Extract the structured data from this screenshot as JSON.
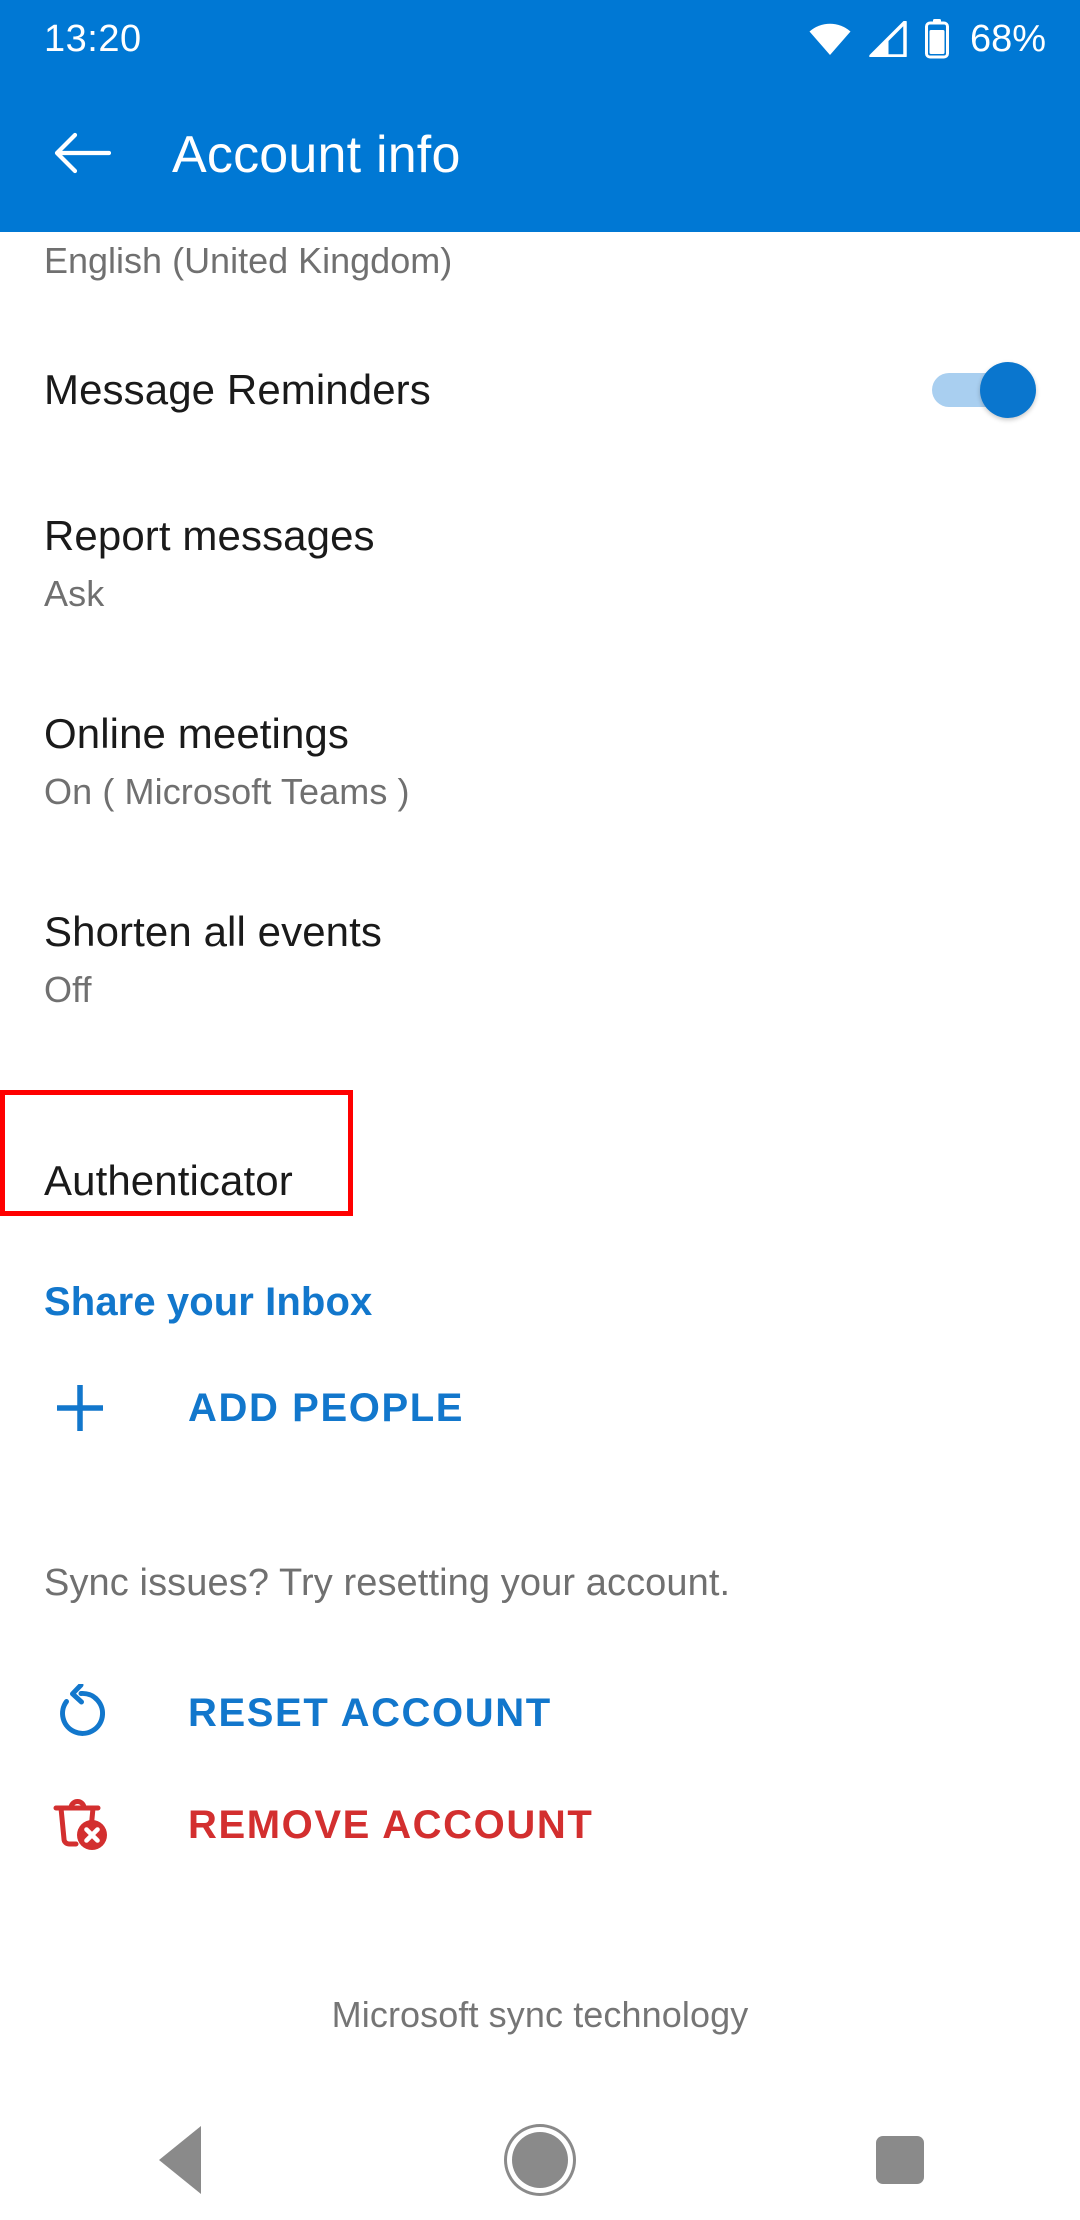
{
  "status_bar": {
    "time": "13:20",
    "battery_percent": "68%",
    "wifi_icon": "wifi-icon",
    "signal_icon": "cellular-signal-icon",
    "battery_icon": "battery-icon"
  },
  "app_bar": {
    "back_icon": "back-arrow-icon",
    "title": "Account info"
  },
  "content": {
    "cut_off_row_subtitle": "English (United Kingdom)",
    "rows": [
      {
        "title": "Message Reminders",
        "subtitle": "",
        "control": "toggle",
        "toggle_state": "on"
      },
      {
        "title": "Report messages",
        "subtitle": "Ask",
        "control": "none"
      },
      {
        "title": "Online meetings",
        "subtitle": "On ( Microsoft Teams )",
        "control": "none"
      },
      {
        "title": "Shorten all events",
        "subtitle": "Off",
        "control": "none"
      },
      {
        "title": "Authenticator",
        "subtitle": "",
        "control": "none",
        "highlighted": true
      }
    ],
    "share_section": {
      "heading": "Share your Inbox",
      "add_people_label": "ADD PEOPLE",
      "add_people_icon": "plus-icon"
    },
    "sync_section": {
      "note": "Sync issues? Try resetting your account.",
      "reset_label": "RESET ACCOUNT",
      "reset_icon": "reset-circular-arrow-icon",
      "remove_label": "REMOVE ACCOUNT",
      "remove_icon": "trash-delete-icon"
    },
    "footer_note": "Microsoft sync technology"
  },
  "nav_bar": {
    "back_icon": "nav-back-triangle-icon",
    "home_icon": "nav-home-circle-icon",
    "recents_icon": "nav-recents-square-icon"
  },
  "colors": {
    "header_blue": "#0078d4",
    "link_blue": "#1277cc",
    "danger_red": "#d32f2f",
    "annotation_red": "#ff0000",
    "toggle_on": "#0a76ce"
  }
}
